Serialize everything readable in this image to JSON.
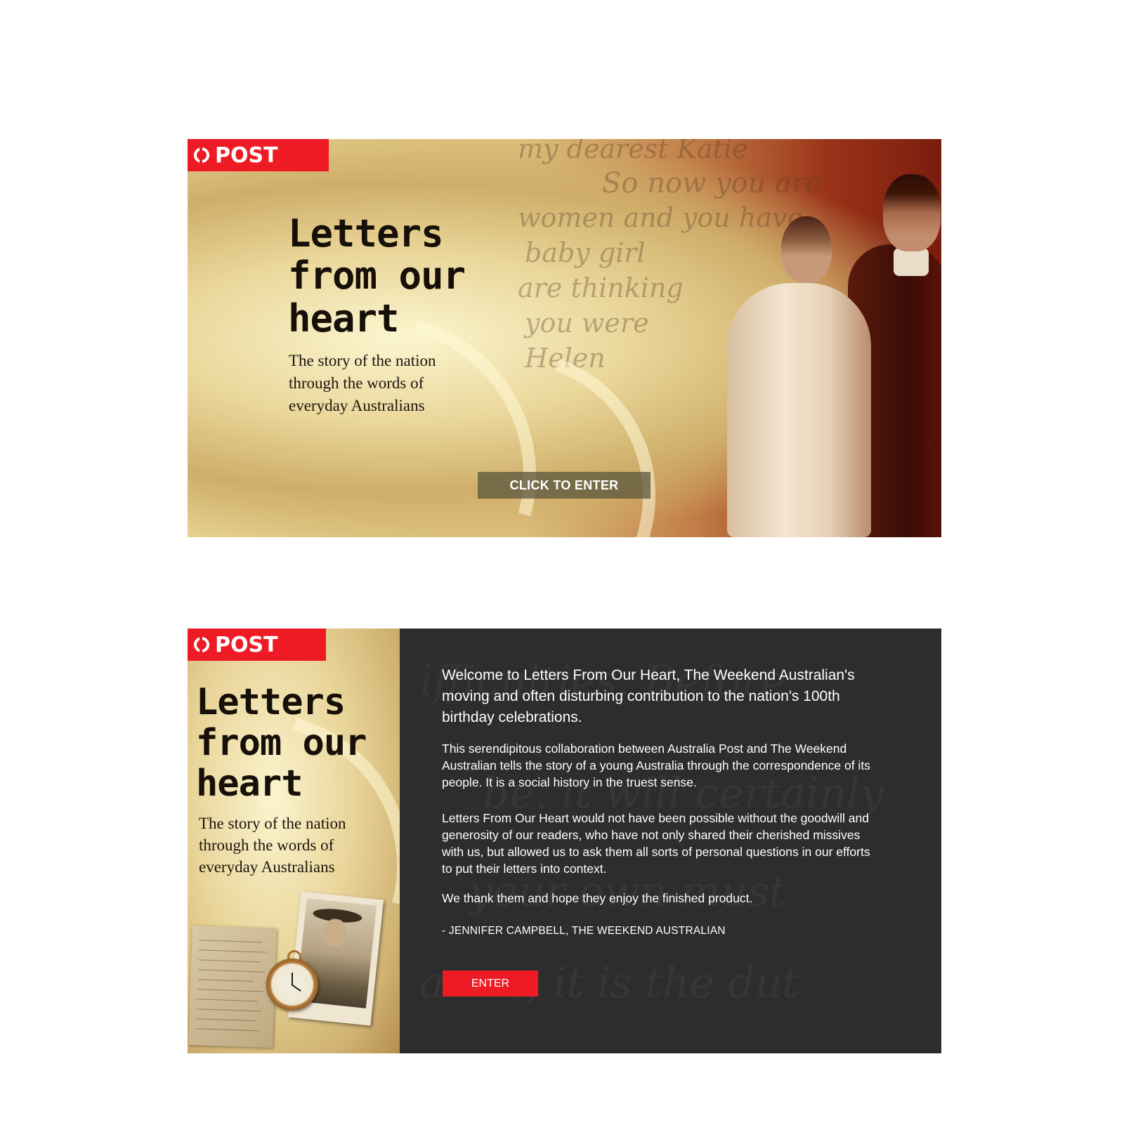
{
  "splash": {
    "logo": {
      "text": "POST",
      "color": "#ee1b24"
    },
    "heading": "Letters from our heart",
    "tagline": "The story of the nation through the words of everyday Australians",
    "cta_label": "CLICK TO ENTER",
    "script_lines": [
      "my dearest Katie",
      "So now you are",
      "women and you have",
      "baby girl",
      "are thinking",
      "you were",
      "Helen"
    ]
  },
  "welcome": {
    "logo": {
      "text": "POST",
      "color": "#ee1b24"
    },
    "heading": "Letters from our heart",
    "tagline": "The story of the nation through the words of everyday Australians",
    "intro": "Welcome to Letters From Our Heart, The Weekend Australian's moving and often disturbing contribution to the nation's 100th birthday celebrations.",
    "paragraph_1": "This serendipitous collaboration between Australia Post and The Weekend Australian tells the story of a young Australia through the correspondence of its people. It is a social history in the truest sense.",
    "paragraph_2": "Letters From Our Heart would not have been possible without the goodwill and generosity of our readers, who have not only shared their cherished missives with us, but allowed us to ask them all sorts of personal questions in our efforts to put their letters into context.",
    "paragraph_3": "We thank them and hope they enjoy the finished product.",
    "signature": "- JENNIFER CAMPBELL, THE WEEKEND AUSTRALIAN",
    "enter_label": "ENTER",
    "accent_color": "#ee1b24",
    "background_color": "#2d2d2d"
  }
}
